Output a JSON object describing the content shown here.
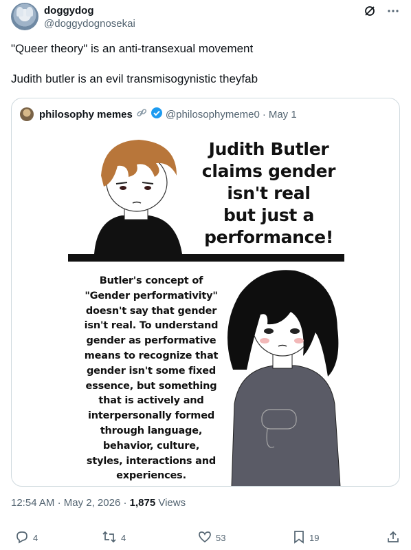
{
  "author": {
    "display_name": "doggydog",
    "handle": "@doggydognosekai"
  },
  "tweet": {
    "line1": "\"Queer theory\" is an anti-transexual movement",
    "line2": "Judith butler is an evil transmisogynistic theyfab"
  },
  "quote": {
    "name": "philosophy memes",
    "handle": "@philosophymeme0",
    "dot": "·",
    "date": "May 1",
    "meme_title": [
      "Judith Butler",
      "claims gender",
      "isn't real",
      "but just a",
      "performance!"
    ],
    "meme_body": [
      "Butler's concept of",
      "\"Gender performativity\"",
      "doesn't say that gender",
      "isn't real. To understand",
      "gender as performative",
      "means to recognize that",
      "gender isn't some fixed",
      "essence, but something",
      "that is actively and",
      "interpersonally formed",
      "through language,",
      "behavior, culture,",
      "styles, interactions and",
      "experiences."
    ]
  },
  "meta": {
    "time": "12:54 AM",
    "sep1": "·",
    "date": "May 2, 2026",
    "sep2": "·",
    "views_count": "1,875",
    "views_label": "Views"
  },
  "actions": {
    "replies": "4",
    "reposts": "4",
    "likes": "53",
    "bookmarks": "19"
  },
  "colors": {
    "verified": "#1d9bf0",
    "text_secondary": "#536471",
    "border": "#cfd9de"
  },
  "icons": [
    "grok-icon",
    "more-icon",
    "link-icon",
    "verified-icon",
    "reply-icon",
    "repost-icon",
    "like-icon",
    "bookmark-icon",
    "share-icon"
  ]
}
